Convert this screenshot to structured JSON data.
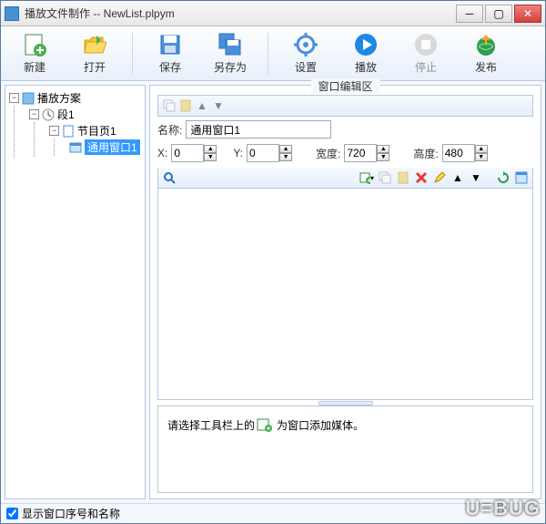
{
  "window": {
    "title": "播放文件制作  --  NewList.plpym"
  },
  "toolbar": {
    "new": "新建",
    "open": "打开",
    "save": "保存",
    "saveas": "另存为",
    "settings": "设置",
    "play": "播放",
    "stop": "停止",
    "publish": "发布"
  },
  "tree": {
    "root": "播放方案",
    "segment": "段1",
    "page": "节目页1",
    "window": "通用窗口1"
  },
  "editor": {
    "group_title": "窗口编辑区",
    "name_label": "名称:",
    "name_value": "通用窗口1",
    "x_label": "X:",
    "x_value": "0",
    "y_label": "Y:",
    "y_value": "0",
    "w_label": "宽度:",
    "w_value": "720",
    "h_label": "高度:",
    "h_value": "480"
  },
  "hint": {
    "before": "请选择工具栏上的",
    "after": "为窗口添加媒体。"
  },
  "footer": {
    "checkbox_label": "显示窗口序号和名称",
    "checked": true
  },
  "watermark": "U=BUG"
}
